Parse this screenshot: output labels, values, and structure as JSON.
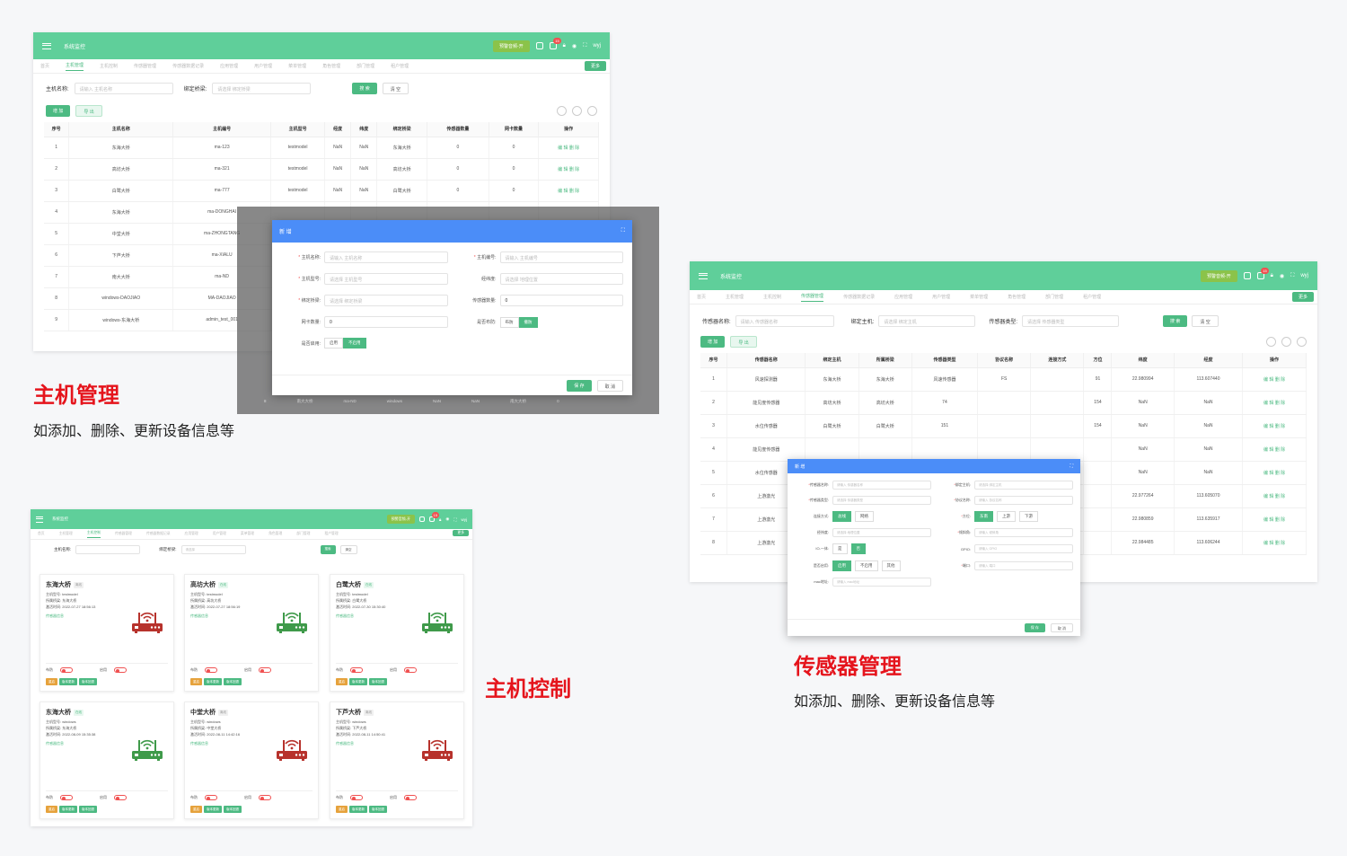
{
  "app": {
    "title": "系统监控",
    "alarm": "预警音频-开",
    "user": "wyj",
    "badge": "15",
    "more": "更多"
  },
  "tabs": [
    "首页",
    "主机管理",
    "主机控制",
    "传感器管理",
    "传感器数据记录",
    "应用管理",
    "用户管理",
    "菜单管理",
    "角色管理",
    "部门管理",
    "租户管理"
  ],
  "host_mgmt": {
    "form": {
      "name_label": "主机名称:",
      "name_ph": "请输入 主机名称",
      "bridge_label": "绑定桥梁:",
      "bridge_ph": "请选择 绑定桥梁",
      "search": "搜 索",
      "clear": "清 空"
    },
    "actions": {
      "add": "增 加",
      "export": "导 出"
    },
    "columns": [
      "序号",
      "主机名称",
      "主机编号",
      "主机型号",
      "经度",
      "纬度",
      "绑定桥梁",
      "传感器数量",
      "网卡数量",
      "操作"
    ],
    "rows": [
      [
        "1",
        "东海大桥",
        "ma-123",
        "testmodel",
        "NaN",
        "NaN",
        "东海大桥",
        "0",
        "0"
      ],
      [
        "2",
        "高坊大桥",
        "ma-321",
        "testmodel",
        "NaN",
        "NaN",
        "高坊大桥",
        "0",
        "0"
      ],
      [
        "3",
        "白鹭大桥",
        "ma-777",
        "testmodel",
        "NaN",
        "NaN",
        "白鹭大桥",
        "0",
        "0"
      ],
      [
        "4",
        "东海大桥",
        "ma-DONGHAI",
        "",
        "",
        "",
        "",
        "",
        ""
      ],
      [
        "5",
        "中堂大桥",
        "ma-ZHONGTANG",
        "",
        "",
        "",
        "",
        "",
        ""
      ],
      [
        "6",
        "下芦大桥",
        "ma-XIALU",
        "",
        "",
        "",
        "",
        "",
        ""
      ],
      [
        "7",
        "南大大桥",
        "ma-ND",
        "",
        "",
        "",
        "",
        "",
        ""
      ],
      [
        "8",
        "windows-DAOJIAO",
        "MA-DAOJIAO",
        "",
        "",
        "",
        "",
        "",
        ""
      ],
      [
        "9",
        "windows-东海大桥",
        "admin_test_001",
        "",
        "",
        "",
        "",
        "",
        ""
      ]
    ],
    "edit": "编 辑",
    "del": "删 除",
    "modal": {
      "title": "新 增",
      "f_name": "主机名称:",
      "f_name_ph": "请输入 主机名称",
      "f_code": "主机编号:",
      "f_code_ph": "请输入 主机编号",
      "f_model": "主机型号:",
      "f_model_ph": "请选择 主机型号",
      "f_lnglat": "经纬度:",
      "f_lnglat_ph": "请选择 地理位置",
      "f_bridge": "绑定桥梁:",
      "f_bridge_ph": "请选择 绑定桥梁",
      "f_sensors": "传感器数量:",
      "f_sensors_val": "0",
      "f_nics": "网卡数量:",
      "f_nics_val": "0",
      "f_deploy": "是否布防:",
      "deploy_on": "布防",
      "deploy_off": "撤防",
      "f_enable": "是否启用:",
      "enable_on": "启用",
      "enable_off": "不启用",
      "save": "保 存",
      "cancel": "取 消"
    },
    "behind_row": [
      "8",
      "南大大桥",
      "ma-ND",
      "windows",
      "NaN",
      "NaN",
      "南大大桥",
      "0"
    ],
    "heading": "主机管理",
    "desc": "如添加、删除、更新设备信息等"
  },
  "sensor_mgmt": {
    "form": {
      "name_label": "传感器名称:",
      "name_ph": "请输入 传感器名称",
      "host_label": "绑定主机:",
      "host_ph": "请选择 绑定主机",
      "type_label": "传感器类型:",
      "type_ph": "请选择 传感器类型",
      "search": "搜 索",
      "clear": "清 空"
    },
    "actions": {
      "add": "增 加",
      "export": "导 出"
    },
    "columns": [
      "序号",
      "传感器名称",
      "绑定主机",
      "所属桥梁",
      "传感器类型",
      "协议名称",
      "连接方式",
      "方位",
      "纬度",
      "经度",
      "操作"
    ],
    "rows": [
      [
        "1",
        "风速探测器",
        "东海大桥",
        "东海大桥",
        "风速传感器",
        "FS",
        "",
        "91",
        "22.980994",
        "113.607440"
      ],
      [
        "2",
        "能见度传感器",
        "高坊大桥",
        "高坊大桥",
        "74",
        "",
        "",
        "154",
        "NaN",
        "NaN"
      ],
      [
        "3",
        "水位传感器",
        "白鹭大桥",
        "白鹭大桥",
        "151",
        "",
        "",
        "154",
        "NaN",
        "NaN"
      ],
      [
        "4",
        "能见度传感器",
        "",
        "",
        "",
        "",
        "",
        "",
        "NaN",
        "NaN"
      ],
      [
        "5",
        "水位传感器",
        "",
        "",
        "",
        "",
        "",
        "",
        "NaN",
        "NaN"
      ],
      [
        "6",
        "上游激光",
        "",
        "",
        "",
        "",
        "",
        "",
        "22.977264",
        "113.605070"
      ],
      [
        "7",
        "上游激光",
        "",
        "",
        "",
        "",
        "",
        "",
        "22.980859",
        "113.635917"
      ],
      [
        "8",
        "上游激光",
        "",
        "",
        "",
        "",
        "",
        "",
        "22.984485",
        "113.606244"
      ]
    ],
    "edit": "编 辑",
    "del": "删 除",
    "modal": {
      "title": "新 增",
      "f_name": "传感器名称:",
      "f_name_ph": "请输入 传感器名称",
      "f_host": "绑定主机:",
      "f_host_ph": "请选择 绑定主机",
      "f_type": "传感器类型:",
      "f_type_ph": "请选择 传感器类型",
      "f_proto": "协议名称:",
      "f_proto_ph": "请输入 协议名称",
      "f_conn": "连接方式:",
      "conn_a": "总线",
      "conn_b": "网络",
      "f_dir": "方位:",
      "dir_a": "东南",
      "dir_b": "上游",
      "dir_c": "下游",
      "f_lnglat": "经纬度:",
      "f_lnglat_ph": "请选择 地理位置",
      "f_angle": "倾斜角:",
      "f_angle_ph": "请输入 倾斜角",
      "f_io": "IO-一体:",
      "io_a": "是",
      "io_b": "否",
      "f_gpio": "GPIO:",
      "f_gpio_ph": "请输入 GPIO",
      "f_enable": "是否启用:",
      "en_a": "启用",
      "en_b": "不启用",
      "en_c": "其他",
      "f_port": "端口:",
      "f_port_ph": "请输入 端口",
      "f_mac": "mac地址:",
      "f_mac_ph": "请输入 mac地址",
      "save": "保 存",
      "cancel": "取 消"
    },
    "heading": "传感器管理",
    "desc": "如添加、删除、更新设备信息等"
  },
  "host_ctrl": {
    "form": {
      "name_label": "主机名称:",
      "bridge_label": "绑定桥梁:",
      "bridge_ph": "请选择",
      "search": "搜索",
      "clear": "清空"
    },
    "labels": {
      "model": "主机型号:",
      "bridge": "所属桥梁:",
      "time": "激活时间:",
      "sensor": "传感器信息",
      "deploy": "布防",
      "enable": "启用",
      "restart": "重启",
      "update": "版本更新",
      "rollback": "版本回退"
    },
    "cards": [
      {
        "name": "东海大桥",
        "status": "离线",
        "model": "testmodel",
        "bridge": "东海大桥",
        "time": "2022-07-27 18:56:13",
        "online": false
      },
      {
        "name": "高坊大桥",
        "status": "在线",
        "model": "testmodel",
        "bridge": "高坊大桥",
        "time": "2022-07-27 18:56:19",
        "online": true
      },
      {
        "name": "白鹭大桥",
        "status": "在线",
        "model": "testmodel",
        "bridge": "白鹭大桥",
        "time": "2022-07-30 15:30:40",
        "online": true
      },
      {
        "name": "东海大桥",
        "status": "在线",
        "model": "windows",
        "bridge": "东海大桥",
        "time": "2022-08-09 15:35:38",
        "online": true
      },
      {
        "name": "中堂大桥",
        "status": "离线",
        "model": "windows",
        "bridge": "中堂大桥",
        "time": "2022-08-11 14:42:16",
        "online": false
      },
      {
        "name": "下芦大桥",
        "status": "离线",
        "model": "windows",
        "bridge": "下芦大桥",
        "time": "2022-08-11 14:50:41",
        "online": false
      }
    ],
    "heading": "主机控制"
  },
  "colors": {
    "brand": "#5fcf9a",
    "accent": "#4cba82",
    "red": "#e5141c",
    "modal": "#4b8df8",
    "online_router": "#3f9a4a",
    "offline_router": "#b7322c"
  }
}
